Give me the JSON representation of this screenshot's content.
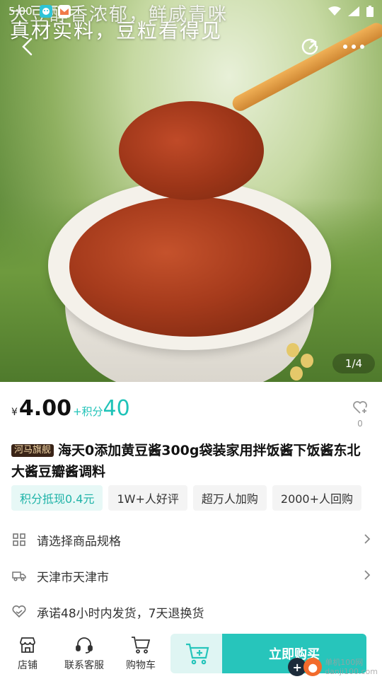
{
  "status": {
    "time": "5:00"
  },
  "hero": {
    "caption_top_faded": "大豆醇香浓郁，鲜咸青咪",
    "caption": "真材实料，豆粒看得见",
    "counter": "1/4"
  },
  "product": {
    "currency": "¥",
    "price": "4.00",
    "points_label": "+积分",
    "points_value": "40",
    "fav_count": "0",
    "store_badge": "河马旗舰",
    "title": "海天0添加黄豆酱300g袋装家用拌饭酱下饭酱东北大酱豆瓣酱调料"
  },
  "tags": [
    "积分抵现0.4元",
    "1W+人好评",
    "超万人加购",
    "2000+人回购"
  ],
  "rows": {
    "spec": "请选择商品规格",
    "address": "天津市天津市",
    "promise": "承诺48小时内发货，7天退换货"
  },
  "bottom": {
    "store": "店铺",
    "service": "联系客服",
    "cart": "购物车",
    "buy_now": "立即购买",
    "watermark_line1": "单机100网",
    "watermark_line2": "danji100.com"
  },
  "colors": {
    "accent": "#27c5bb",
    "accent_text": "#1fc3b8",
    "tag_highlight_bg": "#e7f8f6"
  },
  "icons": [
    "back-icon",
    "share-icon",
    "more-icon",
    "heart-plus-icon",
    "grid-icon",
    "truck-icon",
    "heart-check-icon",
    "store-icon",
    "headset-icon",
    "cart-icon",
    "cart-add-icon"
  ]
}
